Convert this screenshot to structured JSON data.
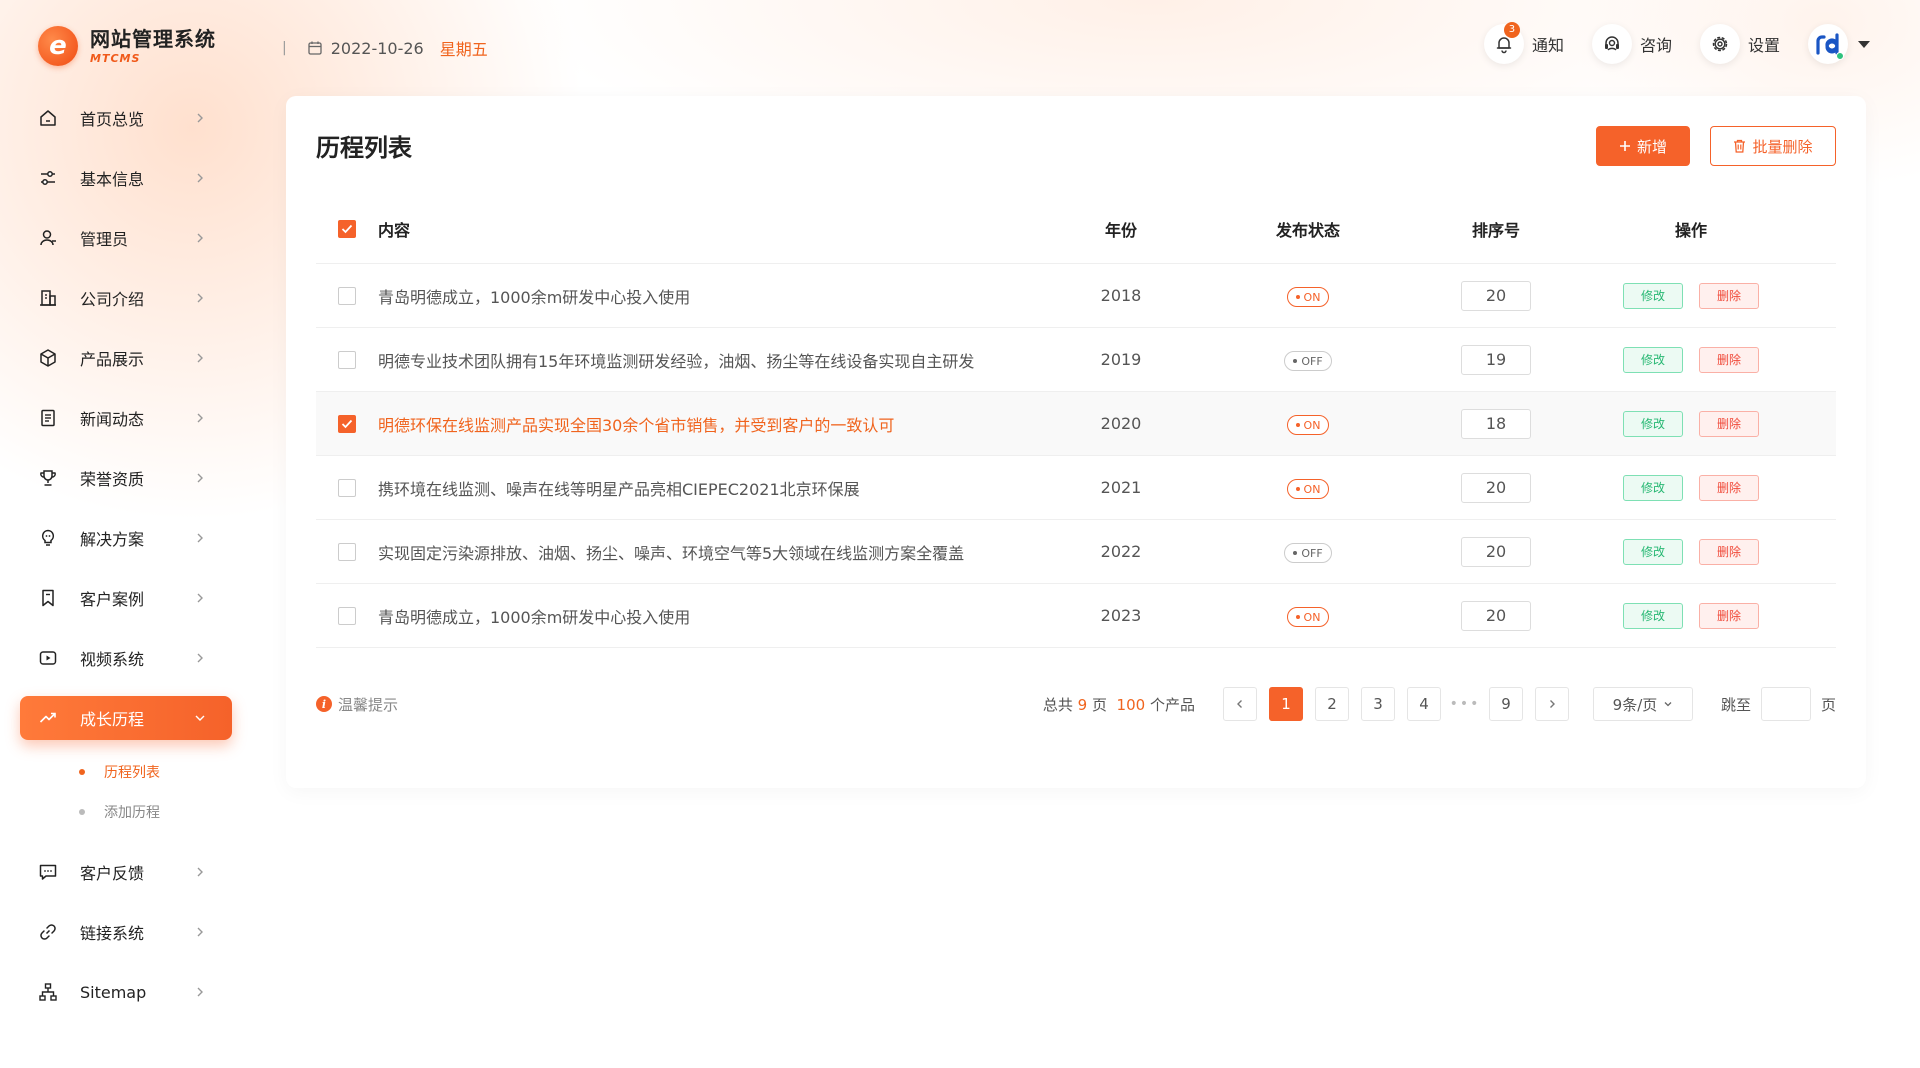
{
  "brand": {
    "logo_letter": "e",
    "title": "网站管理系统",
    "subtitle": "MTCMS"
  },
  "header": {
    "separator": "|",
    "date": "2022-10-26",
    "weekday": "星期五",
    "notify": {
      "label": "通知",
      "badge": "3",
      "icon": "bell-icon"
    },
    "consult": {
      "label": "咨询",
      "icon": "headset-icon"
    },
    "settings": {
      "label": "设置",
      "icon": "gear-icon"
    },
    "avatar": {
      "text": "rd",
      "status_color": "#2ec27e"
    }
  },
  "sidebar": {
    "items": [
      {
        "label": "首页总览",
        "icon": "home-icon"
      },
      {
        "label": "基本信息",
        "icon": "tuning-icon"
      },
      {
        "label": "管理员",
        "icon": "user-icon"
      },
      {
        "label": "公司介绍",
        "icon": "building-icon"
      },
      {
        "label": "产品展示",
        "icon": "cube-icon"
      },
      {
        "label": "新闻动态",
        "icon": "document-icon"
      },
      {
        "label": "荣誉资质",
        "icon": "trophy-icon"
      },
      {
        "label": "解决方案",
        "icon": "lightbulb-icon"
      },
      {
        "label": "客户案例",
        "icon": "bookmark-icon"
      },
      {
        "label": "视频系统",
        "icon": "video-icon"
      },
      {
        "label": "成长历程",
        "icon": "trend-icon",
        "active": true
      },
      {
        "label": "客户反馈",
        "icon": "chat-icon"
      },
      {
        "label": "链接系统",
        "icon": "link-icon"
      },
      {
        "label": "Sitemap",
        "icon": "sitemap-icon"
      }
    ],
    "sub_items": [
      {
        "label": "历程列表",
        "active": true
      },
      {
        "label": "添加历程",
        "active": false
      }
    ]
  },
  "main": {
    "title": "历程列表",
    "add_button": "新增",
    "batch_delete_button": "批量删除",
    "columns": {
      "content": "内容",
      "year": "年份",
      "status": "发布状态",
      "order": "排序号",
      "ops": "操作"
    },
    "rows": [
      {
        "checked": false,
        "content": "青岛明德成立，1000余m研发中心投入使用",
        "year": "2018",
        "status": "ON",
        "order": "20"
      },
      {
        "checked": false,
        "content": "明德专业技术团队拥有15年环境监测研发经验，油烟、扬尘等在线设备实现自主研发",
        "year": "2019",
        "status": "OFF",
        "order": "19"
      },
      {
        "checked": true,
        "content": "明德环保在线监测产品实现全国30余个省市销售，并受到客户的一致认可",
        "year": "2020",
        "status": "ON",
        "order": "18"
      },
      {
        "checked": false,
        "content": "携环境在线监测、噪声在线等明星产品亮相CIEPEC2021北京环保展",
        "year": "2021",
        "status": "ON",
        "order": "20"
      },
      {
        "checked": false,
        "content": "实现固定污染源排放、油烟、扬尘、噪声、环境空气等5大领域在线监测方案全覆盖",
        "year": "2022",
        "status": "OFF",
        "order": "20"
      },
      {
        "checked": false,
        "content": "青岛明德成立，1000余m研发中心投入使用",
        "year": "2023",
        "status": "ON",
        "order": "20"
      }
    ],
    "edit_label": "修改",
    "delete_label": "删除",
    "footer": {
      "tip_icon": "i",
      "tip": "温馨提示",
      "total_prefix": "总共",
      "total_pages": "9",
      "pages_unit": "页",
      "total_items": "100",
      "items_unit": "个产品",
      "pages": [
        "1",
        "2",
        "3",
        "4"
      ],
      "dots": "•••",
      "last_page": "9",
      "current_page": "1",
      "page_size": "9条/页",
      "jump_label": "跳至",
      "jump_value": "",
      "jump_unit": "页"
    }
  },
  "colors": {
    "accent": "#f5622a",
    "edit_green": "#27b873",
    "delete_red": "#f04a3a"
  }
}
